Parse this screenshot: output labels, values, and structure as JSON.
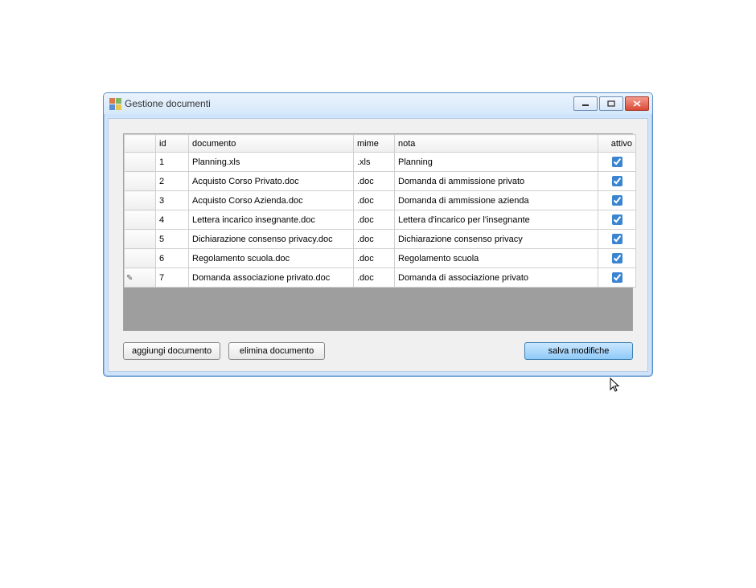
{
  "window": {
    "title": "Gestione documenti"
  },
  "columns": {
    "id": "id",
    "documento": "documento",
    "mime": "mime",
    "nota": "nota",
    "attivo": "attivo"
  },
  "rows": [
    {
      "id": "1",
      "documento": "Planning.xls",
      "mime": ".xls",
      "nota": "Planning",
      "attivo": true,
      "editing": false
    },
    {
      "id": "2",
      "documento": "Acquisto Corso Privato.doc",
      "mime": ".doc",
      "nota": "Domanda di ammissione privato",
      "attivo": true,
      "editing": false
    },
    {
      "id": "3",
      "documento": "Acquisto Corso Azienda.doc",
      "mime": ".doc",
      "nota": "Domanda di ammissione azienda",
      "attivo": true,
      "editing": false
    },
    {
      "id": "4",
      "documento": "Lettera incarico insegnante.doc",
      "mime": ".doc",
      "nota": "Lettera d'incarico per l'insegnante",
      "attivo": true,
      "editing": false
    },
    {
      "id": "5",
      "documento": "Dichiarazione consenso privacy.doc",
      "mime": ".doc",
      "nota": "Dichiarazione consenso privacy",
      "attivo": true,
      "editing": false
    },
    {
      "id": "6",
      "documento": "Regolamento scuola.doc",
      "mime": ".doc",
      "nota": "Regolamento scuola",
      "attivo": true,
      "editing": false
    },
    {
      "id": "7",
      "documento": "Domanda associazione privato.doc",
      "mime": ".doc",
      "nota": "Domanda di associazione privato",
      "attivo": true,
      "editing": true
    }
  ],
  "buttons": {
    "add": "aggiungi documento",
    "delete": "elimina documento",
    "save": "salva modifiche"
  }
}
